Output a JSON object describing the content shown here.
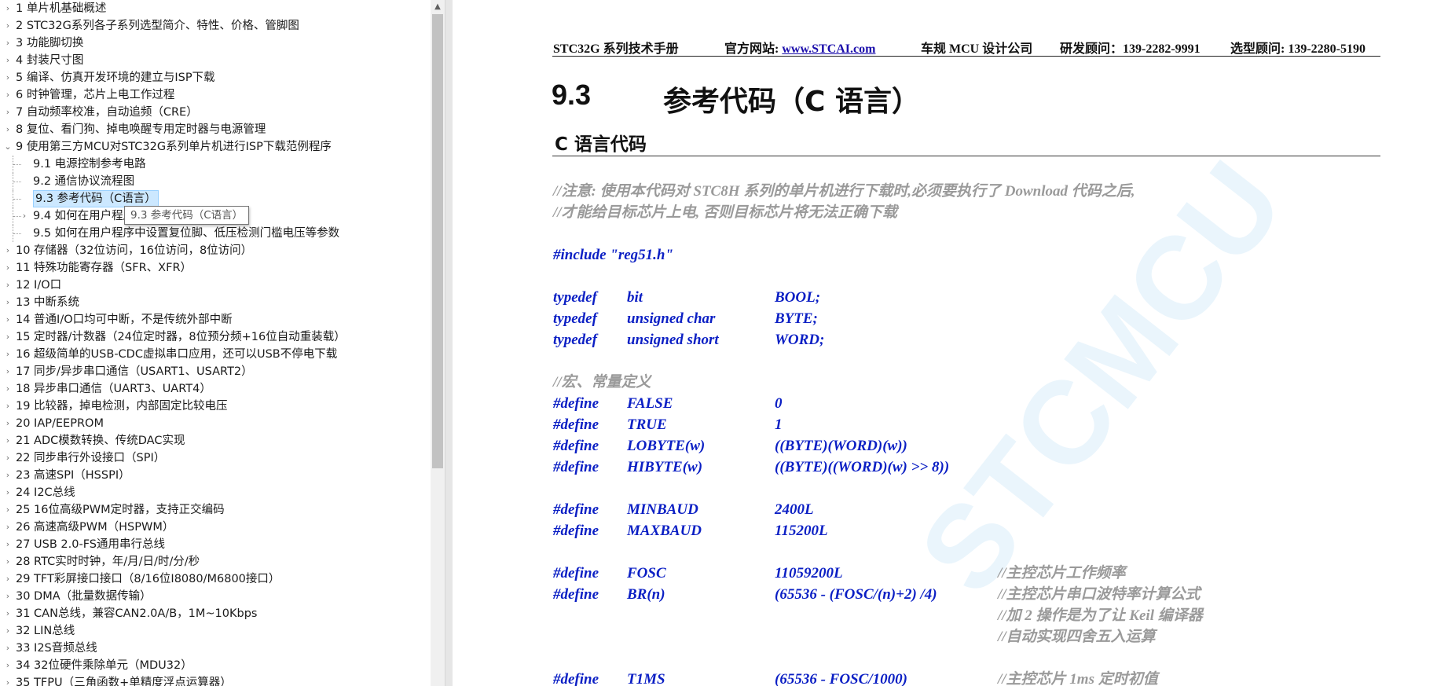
{
  "sidebar": {
    "tooltip": "9.3 参考代码（C语言）",
    "items": [
      {
        "label": "1 单片机基础概述",
        "level": 0,
        "expander": "collapsed"
      },
      {
        "label": "2 STC32G系列各子系列选型简介、特性、价格、管脚图",
        "level": 0,
        "expander": "collapsed"
      },
      {
        "label": "3 功能脚切换",
        "level": 0,
        "expander": "collapsed"
      },
      {
        "label": "4 封装尺寸图",
        "level": 0,
        "expander": "collapsed"
      },
      {
        "label": "5 编译、仿真开发环境的建立与ISP下载",
        "level": 0,
        "expander": "collapsed"
      },
      {
        "label": "6 时钟管理，芯片上电工作过程",
        "level": 0,
        "expander": "collapsed"
      },
      {
        "label": "7 自动频率校准，自动追频（CRE）",
        "level": 0,
        "expander": "collapsed"
      },
      {
        "label": "8 复位、看门狗、掉电唤醒专用定时器与电源管理",
        "level": 0,
        "expander": "collapsed"
      },
      {
        "label": "9 使用第三方MCU对STC32G系列单片机进行ISP下载范例程序",
        "level": 0,
        "expander": "expanded"
      },
      {
        "label": "9.1 电源控制参考电路",
        "level": 1,
        "expander": "none"
      },
      {
        "label": "9.2 通信协议流程图",
        "level": 1,
        "expander": "none"
      },
      {
        "label": "9.3 参考代码（C语言）",
        "level": 1,
        "expander": "none",
        "selected": true
      },
      {
        "label": "9.4 如何在用户程序中设置IRC工作频率",
        "level": 1,
        "expander": "collapsed"
      },
      {
        "label": "9.5 如何在用户程序中设置复位脚、低压检测门槛电压等参数",
        "level": 1,
        "expander": "none"
      },
      {
        "label": "10 存储器（32位访问，16位访问，8位访问）",
        "level": 0,
        "expander": "collapsed"
      },
      {
        "label": "11 特殊功能寄存器（SFR、XFR）",
        "level": 0,
        "expander": "collapsed"
      },
      {
        "label": "12 I/O口",
        "level": 0,
        "expander": "collapsed"
      },
      {
        "label": "13 中断系统",
        "level": 0,
        "expander": "collapsed"
      },
      {
        "label": "14 普通I/O口均可中断，不是传统外部中断",
        "level": 0,
        "expander": "collapsed"
      },
      {
        "label": "15 定时器/计数器（24位定时器，8位预分频+16位自动重装载）",
        "level": 0,
        "expander": "collapsed"
      },
      {
        "label": "16 超级简单的USB-CDC虚拟串口应用，还可以USB不停电下载",
        "level": 0,
        "expander": "collapsed"
      },
      {
        "label": "17 同步/异步串口通信（USART1、USART2）",
        "level": 0,
        "expander": "collapsed"
      },
      {
        "label": "18 异步串口通信（UART3、UART4）",
        "level": 0,
        "expander": "collapsed"
      },
      {
        "label": "19 比较器，掉电检测，内部固定比较电压",
        "level": 0,
        "expander": "collapsed"
      },
      {
        "label": "20 IAP/EEPROM",
        "level": 0,
        "expander": "collapsed"
      },
      {
        "label": "21 ADC模数转换、传统DAC实现",
        "level": 0,
        "expander": "collapsed"
      },
      {
        "label": "22 同步串行外设接口（SPI）",
        "level": 0,
        "expander": "collapsed"
      },
      {
        "label": "23 高速SPI（HSSPI）",
        "level": 0,
        "expander": "collapsed"
      },
      {
        "label": "24 I2C总线",
        "level": 0,
        "expander": "collapsed"
      },
      {
        "label": "25 16位高级PWM定时器，支持正交编码",
        "level": 0,
        "expander": "collapsed"
      },
      {
        "label": "26 高速高级PWM（HSPWM）",
        "level": 0,
        "expander": "collapsed"
      },
      {
        "label": "27 USB 2.0-FS通用串行总线",
        "level": 0,
        "expander": "collapsed"
      },
      {
        "label": "28 RTC实时时钟，年/月/日/时/分/秒",
        "level": 0,
        "expander": "collapsed"
      },
      {
        "label": "29 TFT彩屏接口接口（8/16位I8080/M6800接口）",
        "level": 0,
        "expander": "collapsed"
      },
      {
        "label": "30 DMA（批量数据传输）",
        "level": 0,
        "expander": "collapsed"
      },
      {
        "label": "31 CAN总线，兼容CAN2.0A/B，1M~10Kbps",
        "level": 0,
        "expander": "collapsed"
      },
      {
        "label": "32 LIN总线",
        "level": 0,
        "expander": "collapsed"
      },
      {
        "label": "33 I2S音频总线",
        "level": 0,
        "expander": "collapsed"
      },
      {
        "label": "34 32位硬件乘除单元（MDU32）",
        "level": 0,
        "expander": "collapsed"
      },
      {
        "label": "35 TFPU（三角函数+单精度浮点运算器）",
        "level": 0,
        "expander": "collapsed"
      }
    ]
  },
  "document": {
    "header": {
      "manual": "STC32G 系列技术手册",
      "website_label": "官方网站: ",
      "website_url": "www.STCAI.com",
      "company": "车规 MCU 设计公司",
      "rd_consultant": "研发顾问：139-2282-9991",
      "selection_consultant": "选型顾问: 139-2280-5190"
    },
    "section_number": "9.3",
    "section_title": "参考代码（C 语言）",
    "subsection_title": "C 语言代码",
    "code_lines": [
      {
        "kind": "comment",
        "cols": [
          "//注意: 使用本代码对 STC8H 系列的单片机进行下载时,必须要执行了 Download 代码之后,"
        ]
      },
      {
        "kind": "comment",
        "cols": [
          "//才能给目标芯片上电, 否则目标芯片将无法正确下载"
        ]
      },
      {
        "kind": "code",
        "cols": [
          "#include \"reg51.h\""
        ]
      },
      {
        "kind": "code",
        "cols": [
          "typedef",
          "bit",
          "BOOL;"
        ]
      },
      {
        "kind": "code",
        "cols": [
          "typedef",
          "unsigned char",
          "BYTE;"
        ]
      },
      {
        "kind": "code",
        "cols": [
          "typedef",
          "unsigned short",
          "WORD;"
        ]
      },
      {
        "kind": "comment",
        "cols": [
          "//宏、常量定义"
        ]
      },
      {
        "kind": "code",
        "cols": [
          "#define",
          "FALSE",
          "0"
        ]
      },
      {
        "kind": "code",
        "cols": [
          "#define",
          "TRUE",
          "1"
        ]
      },
      {
        "kind": "code",
        "cols": [
          "#define",
          "LOBYTE(w)",
          "((BYTE)(WORD)(w))"
        ]
      },
      {
        "kind": "code",
        "cols": [
          "#define",
          "HIBYTE(w)",
          "((BYTE)((WORD)(w) >> 8))"
        ]
      },
      {
        "kind": "code",
        "cols": [
          "#define",
          "MINBAUD",
          "2400L"
        ]
      },
      {
        "kind": "code",
        "cols": [
          "#define",
          "MAXBAUD",
          "115200L"
        ]
      },
      {
        "kind": "code",
        "cols": [
          "#define",
          "FOSC",
          "11059200L"
        ],
        "comment": "//主控芯片工作频率"
      },
      {
        "kind": "code",
        "cols": [
          "#define",
          "BR(n)",
          "(65536 - (FOSC/(n)+2) /4)"
        ],
        "comment": "//主控芯片串口波特率计算公式"
      },
      {
        "kind": "comment_only",
        "comment": "//加 2 操作是为了让 Keil 编译器"
      },
      {
        "kind": "comment_only",
        "comment": "//自动实现四舍五入运算"
      },
      {
        "kind": "code",
        "cols": [
          "#define",
          "T1MS",
          "(65536 - FOSC/1000)"
        ],
        "comment": "//主控芯片 1ms 定时初值"
      }
    ],
    "watermark": "STCMCU"
  }
}
